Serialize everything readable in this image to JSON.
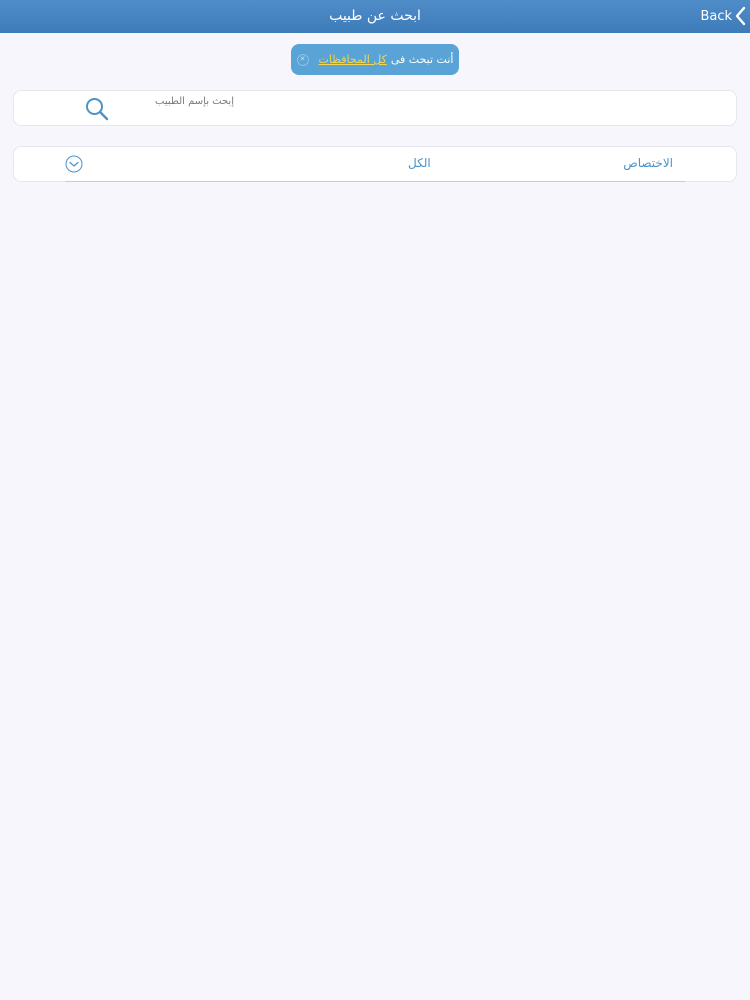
{
  "navbar": {
    "title": "ابحث عن طبيب",
    "back_label": "Back"
  },
  "banner": {
    "prefix": "أنت تبحث فى",
    "link": "كل المحافظات"
  },
  "search": {
    "placeholder": "إبحث بإسم الطبيب"
  },
  "filter": {
    "label": "الاختصاص",
    "value": "الكل"
  },
  "colors": {
    "navbar": "#3e7bb9",
    "banner": "#5aa3d7",
    "banner_link": "#f4d64a",
    "accent": "#4b93c8",
    "background": "#f7f6fc"
  }
}
